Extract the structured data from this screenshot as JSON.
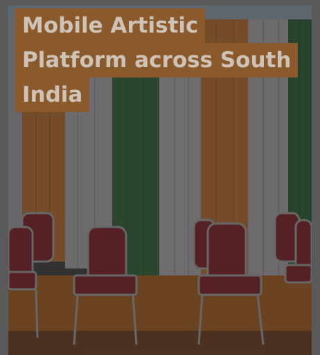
{
  "caption": {
    "lines": [
      "Mobile Artistic",
      "Platform across South",
      "India"
    ]
  },
  "colors": {
    "caption_bg": "#8a5a2d",
    "caption_text": "#cfc3b8",
    "saffron": "#c9742c",
    "white_drape": "#c8c2c6",
    "green_drape": "#2f6e3c",
    "chair_red": "#7e1e25",
    "floor": "#b9651a"
  },
  "image": {
    "subject": "photo"
  }
}
